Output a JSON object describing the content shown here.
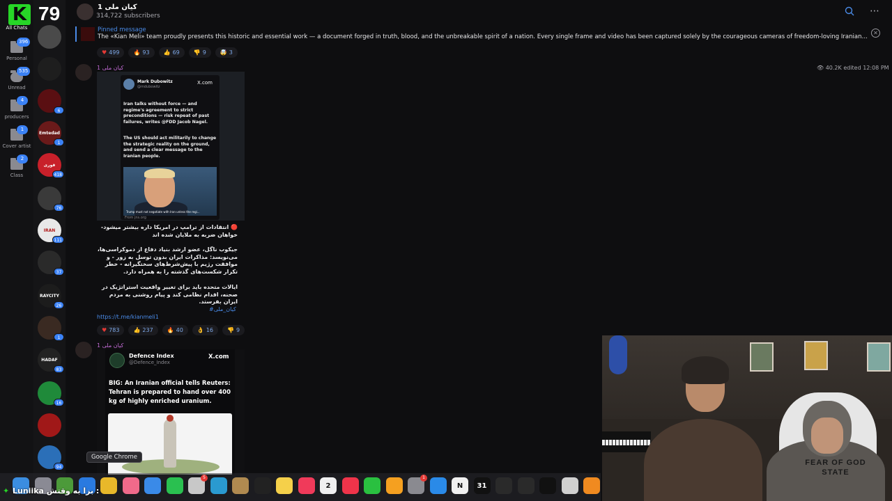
{
  "brand": {
    "logo_letter": "K",
    "counter": "79"
  },
  "folders": [
    {
      "label": "All Chats",
      "badge": ""
    },
    {
      "label": "Personal",
      "badge": "396"
    },
    {
      "label": "Unread",
      "badge": "535"
    },
    {
      "label": "producers",
      "badge": "4"
    },
    {
      "label": "Cover artist",
      "badge": "1"
    },
    {
      "label": "Class",
      "badge": "2"
    }
  ],
  "chat_avatars": [
    {
      "text": "",
      "color": "#4a4a4a",
      "badge": ""
    },
    {
      "text": "",
      "color": "#1e1e1e",
      "badge": ""
    },
    {
      "text": "",
      "color": "#5a0f12",
      "badge": "6"
    },
    {
      "text": "Emtedad",
      "color": "#6a1a1a",
      "badge": "1"
    },
    {
      "text": "قوری",
      "color": "#c8202a",
      "badge": "418"
    },
    {
      "text": "",
      "color": "#3a3a3a",
      "badge": "76"
    },
    {
      "text": "IRAN",
      "color": "#e8e8e8",
      "badge": "111"
    },
    {
      "text": "",
      "color": "#2a2a2a",
      "badge": "37"
    },
    {
      "text": "RAYCITY",
      "color": "#1c1c1c",
      "badge": "26"
    },
    {
      "text": "",
      "color": "#3a2a22",
      "badge": "1"
    },
    {
      "text": "HADAF",
      "color": "#222222",
      "badge": "83"
    },
    {
      "text": "",
      "color": "#1f8a3a",
      "badge": "16"
    },
    {
      "text": "",
      "color": "#a01818",
      "badge": ""
    },
    {
      "text": "",
      "color": "#2b6fb8",
      "badge": "94"
    }
  ],
  "header": {
    "channel_name": "کیان ملی 1",
    "subscribers": "314,722 subscribers"
  },
  "pinned": {
    "label": "Pinned message",
    "text": "The «Kian Meli» team proudly presents this historic and essential work — a document forged in truth, blood, and the unbreakable spirit of a nation.  Every single frame and video has been captured solely by the courageous cameras of freedom-loving Iranians — raw, uncens..."
  },
  "reactions_top": [
    {
      "icon": "♥",
      "color": "#e53935",
      "count": "499"
    },
    {
      "icon": "🔥",
      "color": "#ff7a1a",
      "count": "93"
    },
    {
      "icon": "👍",
      "color": "#f5c542",
      "count": "69"
    },
    {
      "icon": "👎",
      "color": "#f5c542",
      "count": "9"
    },
    {
      "icon": "🤯",
      "color": "#f5c542",
      "count": "3"
    }
  ],
  "message1": {
    "author": "کیان ملی 1",
    "views": "40.2K",
    "edited": "edited 12:08 PM",
    "tweet": {
      "name": "Mark Dubowitz",
      "handle": "@mdubowitz",
      "brand": "X.com",
      "p1": "Iran talks without force — and regime's agreement to strict preconditions — risk repeat of past failures, writes @FDD Jacob Nagel.",
      "p2": "The US should act militarily to change the strategic reality on the ground, and send a clear message to the Iranian people.",
      "caption": "Trump must not negotiate with Iran unless the regi...",
      "from": "From jns.org"
    },
    "fa1": "🔴 انتقادات از ترامپ در امریکا داره بیشتر میشود-خواهان ضربه به ملایان شده اند",
    "fa2": "جیکوب ناگل، عضو ارشد بنیاد دفاع از دموکراسی‌ها، می‌نویسد: مذاکرات ایران بدون توسل به زور - و موافقت رژیم با پیش‌شرط‌های سختگیرانه - خطر تکرار شکست‌های گذشته را به همراه دارد.",
    "fa3": "ایالات متحده باید برای تغییر واقعیت استراتژیک در صحنه، اقدام نظامی کند و پیام روشنی به مردم ایران بفرستد.",
    "hashtag": "#کیان_ملی",
    "link": "https://t.me/kianmeli1"
  },
  "reactions_mid": [
    {
      "icon": "♥",
      "color": "#e53935",
      "count": "783"
    },
    {
      "icon": "👍",
      "color": "#f5c542",
      "count": "237"
    },
    {
      "icon": "🔥",
      "color": "#ff7a1a",
      "count": "40"
    },
    {
      "icon": "👌",
      "color": "#f5c542",
      "count": "16"
    },
    {
      "icon": "👎",
      "color": "#f5c542",
      "count": "9"
    }
  ],
  "message2": {
    "author": "کیان ملی 1",
    "tweet": {
      "name": "Defence Index",
      "handle": "@Defence_Index",
      "brand": "X.com",
      "body": "BIG: An Iranian official tells Reuters: Tehran is prepared to hand over 400 kg of highly enriched uranium."
    }
  },
  "webcam": {
    "shirt_text": "FEAR OF GOD STATE"
  },
  "dock": {
    "tooltip": "Google Chrome",
    "ticker_name": "Luniika",
    "ticker_text": "بزا به وقتش :",
    "icons": [
      {
        "name": "finder-icon",
        "color": "#3b8de0"
      },
      {
        "name": "launchpad-icon",
        "color": "#8a8a94"
      },
      {
        "name": "chrome-alt-icon",
        "color": "#4c9a3a"
      },
      {
        "name": "safari-icon",
        "color": "#2a7ae0"
      },
      {
        "name": "chrome-icon",
        "color": "#e8b82a"
      },
      {
        "name": "photos-icon",
        "color": "#f06a8a"
      },
      {
        "name": "mail-icon",
        "color": "#3a8ae8"
      },
      {
        "name": "facetime-icon",
        "color": "#2ac050"
      },
      {
        "name": "contacts-icon",
        "color": "#c8c8c8",
        "badge": "5"
      },
      {
        "name": "preview-icon",
        "color": "#2a9ad0"
      },
      {
        "name": "archive-icon",
        "color": "#b08a50"
      },
      {
        "name": "appletv-icon",
        "color": "#222222"
      },
      {
        "name": "notes-icon",
        "color": "#f5d04a"
      },
      {
        "name": "music-icon",
        "color": "#f03a5a"
      },
      {
        "name": "calendar-icon",
        "color": "#f0f0f0",
        "text": "2"
      },
      {
        "name": "news-icon",
        "color": "#f0344a"
      },
      {
        "name": "numbers-icon",
        "color": "#2ac040"
      },
      {
        "name": "pages-icon",
        "color": "#f5a020"
      },
      {
        "name": "settings-icon",
        "color": "#8a8a90",
        "badge": "1"
      },
      {
        "name": "appstore-icon",
        "color": "#2a8ae8"
      },
      {
        "name": "notion-icon",
        "color": "#f0f0f0",
        "text": "N"
      },
      {
        "name": "calendar31-icon",
        "color": "#111111",
        "text": "31"
      },
      {
        "name": "audio-app-icon",
        "color": "#2a2a2a"
      },
      {
        "name": "audio-app2-icon",
        "color": "#2a2a2a"
      },
      {
        "name": "unity-icon",
        "color": "#111111"
      },
      {
        "name": "utility-icon",
        "color": "#d0d0d0"
      },
      {
        "name": "blender-icon",
        "color": "#f08a20"
      }
    ]
  }
}
